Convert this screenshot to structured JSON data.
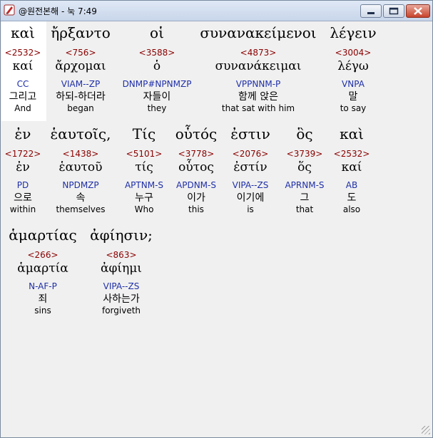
{
  "window": {
    "title": "@원전본해 - 눅 7:49"
  },
  "icons": {
    "app": "pen-icon",
    "minimize": "minimize-icon",
    "maximize": "maximize-icon",
    "close": "close-icon"
  },
  "rows": [
    {
      "words": [
        {
          "greek": "καὶ",
          "strong": "<2532>",
          "lemma": "καί",
          "morph": "CC",
          "korean": "그리고",
          "english": "And"
        },
        {
          "greek": "ἤρξαντο",
          "strong": "<756>",
          "lemma": "ἄρχομαι",
          "morph": "VIAM--ZP",
          "korean": "하되-하더라",
          "english": "began"
        },
        {
          "greek": "οἱ",
          "strong": "<3588>",
          "lemma": "ὁ",
          "morph": "DNMP#NPNMZP",
          "korean": "자들이",
          "english": "they"
        },
        {
          "greek": "συνανακείμενοι",
          "strong": "<4873>",
          "lemma": "συνανάκειμαι",
          "morph": "VPPNNM-P",
          "korean": "함께 앉은",
          "english": "that sat with him"
        },
        {
          "greek": "λέγειν",
          "strong": "<3004>",
          "lemma": "λέγω",
          "morph": "VNPA",
          "korean": "말",
          "english": "to say"
        }
      ]
    },
    {
      "words": [
        {
          "greek": "ἐν",
          "strong": "<1722>",
          "lemma": "ἐν",
          "morph": "PD",
          "korean": "으로",
          "english": "within"
        },
        {
          "greek": "ἑαυτοῖς,",
          "strong": "<1438>",
          "lemma": "ἑαυτοῦ",
          "morph": "NPDMZP",
          "korean": "속",
          "english": "themselves"
        },
        {
          "greek": "Τίς",
          "strong": "<5101>",
          "lemma": "τίς",
          "morph": "APTNM-S",
          "korean": "누구",
          "english": "Who"
        },
        {
          "greek": "οὗτός",
          "strong": "<3778>",
          "lemma": "οὗτος",
          "morph": "APDNM-S",
          "korean": "이가",
          "english": "this"
        },
        {
          "greek": "ἐστιν",
          "strong": "<2076>",
          "lemma": "ἐστίν",
          "morph": "VIPA--ZS",
          "korean": "이기에",
          "english": "is"
        },
        {
          "greek": "ὃς",
          "strong": "<3739>",
          "lemma": "ὅς",
          "morph": "APRNM-S",
          "korean": "그",
          "english": "that"
        },
        {
          "greek": "καὶ",
          "strong": "<2532>",
          "lemma": "καί",
          "morph": "AB",
          "korean": "도",
          "english": "also"
        }
      ]
    },
    {
      "words": [
        {
          "greek": "ἁμαρτίας",
          "strong": "<266>",
          "lemma": "ἁμαρτία",
          "morph": "N-AF-P",
          "korean": "죄",
          "english": "sins"
        },
        {
          "greek": "ἀφίησιν;",
          "strong": "<863>",
          "lemma": "ἀφίημι",
          "morph": "VIPA--ZS",
          "korean": "사하는가",
          "english": "forgiveth"
        }
      ]
    }
  ]
}
